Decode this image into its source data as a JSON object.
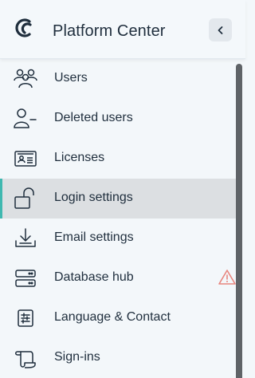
{
  "header": {
    "title": "Platform Center",
    "logo_icon": "platform-logo-icon",
    "collapse_icon": "chevron-left-icon"
  },
  "nav": {
    "items": [
      {
        "label": "Users",
        "icon": "users-icon"
      },
      {
        "label": "Deleted users",
        "icon": "user-minus-icon"
      },
      {
        "label": "Licenses",
        "icon": "id-card-icon"
      },
      {
        "label": "Login settings",
        "icon": "unlock-icon",
        "active": true
      },
      {
        "label": "Email settings",
        "icon": "download-tray-icon"
      },
      {
        "label": "Database hub",
        "icon": "server-icon",
        "warning_icon": "warning-triangle-icon"
      },
      {
        "label": "Language & Contact",
        "icon": "sliders-icon"
      },
      {
        "label": "Sign-ins",
        "icon": "scroll-icon"
      }
    ]
  },
  "colors": {
    "background": "#f3f7fa",
    "active_item": "#dcdfe2",
    "active_accent": "#3fb8b0",
    "text": "#1f2e3d",
    "warning": "#e8857e"
  }
}
